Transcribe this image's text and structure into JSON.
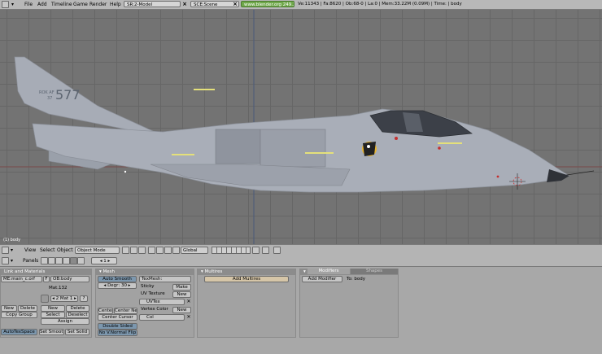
{
  "menu": {
    "items": [
      "File",
      "Add",
      "Timeline",
      "Game",
      "Render",
      "Help"
    ],
    "screen_field": "SR:2-Model",
    "scene_field": "SCE:Scene",
    "url": "www.blender.org 249.2",
    "stats": "Ve:11343 | Fa:8620 | Ob:68-0 | La:0  | Mem:33.22M (0.09M) | Time: | body"
  },
  "viewport": {
    "tail_text_top": "ROK AF",
    "tail_text_num": "37",
    "tail_big_num": "577",
    "object_label": "(1) body"
  },
  "view_header": {
    "items": [
      "View",
      "Select",
      "Object"
    ],
    "mode": "Object Mode",
    "orientation": "Global"
  },
  "buttons_header": {
    "panels_label": "Panels",
    "frame": "1"
  },
  "link_materials": {
    "title": "Link and Materials",
    "me_field": "ME:main_c.orf",
    "f_label": "F",
    "ob_field": "OB:body",
    "mat_name": "Mat.132",
    "mat_slot": "2 Mat 1",
    "q": "?",
    "new": "New",
    "delete": "Delete",
    "new2": "New",
    "delete2": "Delete",
    "copy_group": "Copy Group",
    "select": "Select",
    "deselect": "Deselect",
    "assign": "Assign",
    "autotexspace": "AutoTexSpace",
    "set_smooth": "Set Smooth",
    "set_solid": "Set Solid"
  },
  "mesh": {
    "title": "Mesh",
    "auto_smooth": "Auto Smooth",
    "degr": "Degr: 30",
    "texmesh": "TexMesh:",
    "sticky": "Sticky",
    "make": "Make",
    "uv_texture": "UV Texture",
    "new": "New",
    "uvtex": "UVTex",
    "vertex_color": "Vertex Color",
    "new2": "New",
    "col": "Col",
    "center": "Center",
    "center_new": "Center New",
    "center_cursor": "Center Cursor",
    "double_sided": "Double Sided",
    "no_v_normal_flip": "No V.Normal Flip"
  },
  "multires": {
    "title": "Multires",
    "add": "Add Multires"
  },
  "modifiers": {
    "tab1": "Modifiers",
    "tab2": "Shapes",
    "add": "Add Modifier",
    "to": "To: body"
  }
}
